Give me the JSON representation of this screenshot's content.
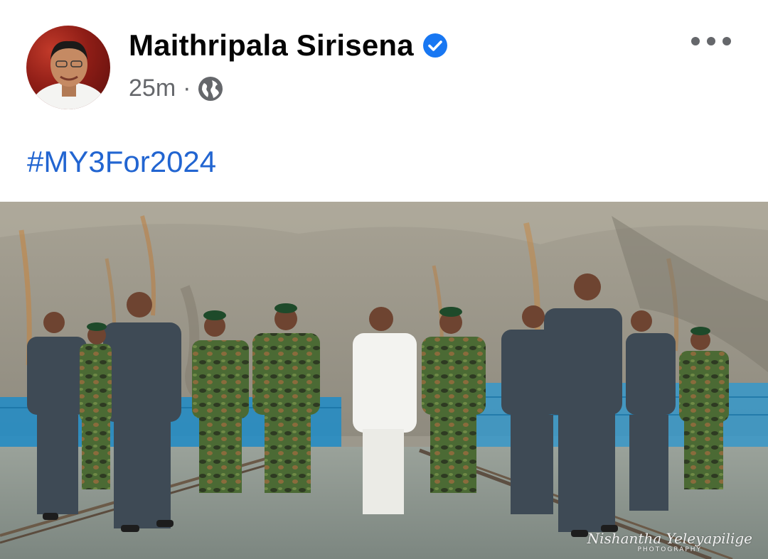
{
  "post": {
    "author": "Maithripala Sirisena",
    "verified": true,
    "time": "25m",
    "separator": "·",
    "audience_icon": "globe-icon",
    "hashtag": "#MY3For2024",
    "more_icon": "more-horizontal-icon",
    "photo": {
      "watermark_script": "Nishantha Yeleyapilige",
      "watermark_sub": "PHOTOGRAPHY"
    }
  },
  "colors": {
    "name": "#050505",
    "meta": "#65676b",
    "hashtag": "#2265d1",
    "verified_badge": "#1877f2"
  }
}
